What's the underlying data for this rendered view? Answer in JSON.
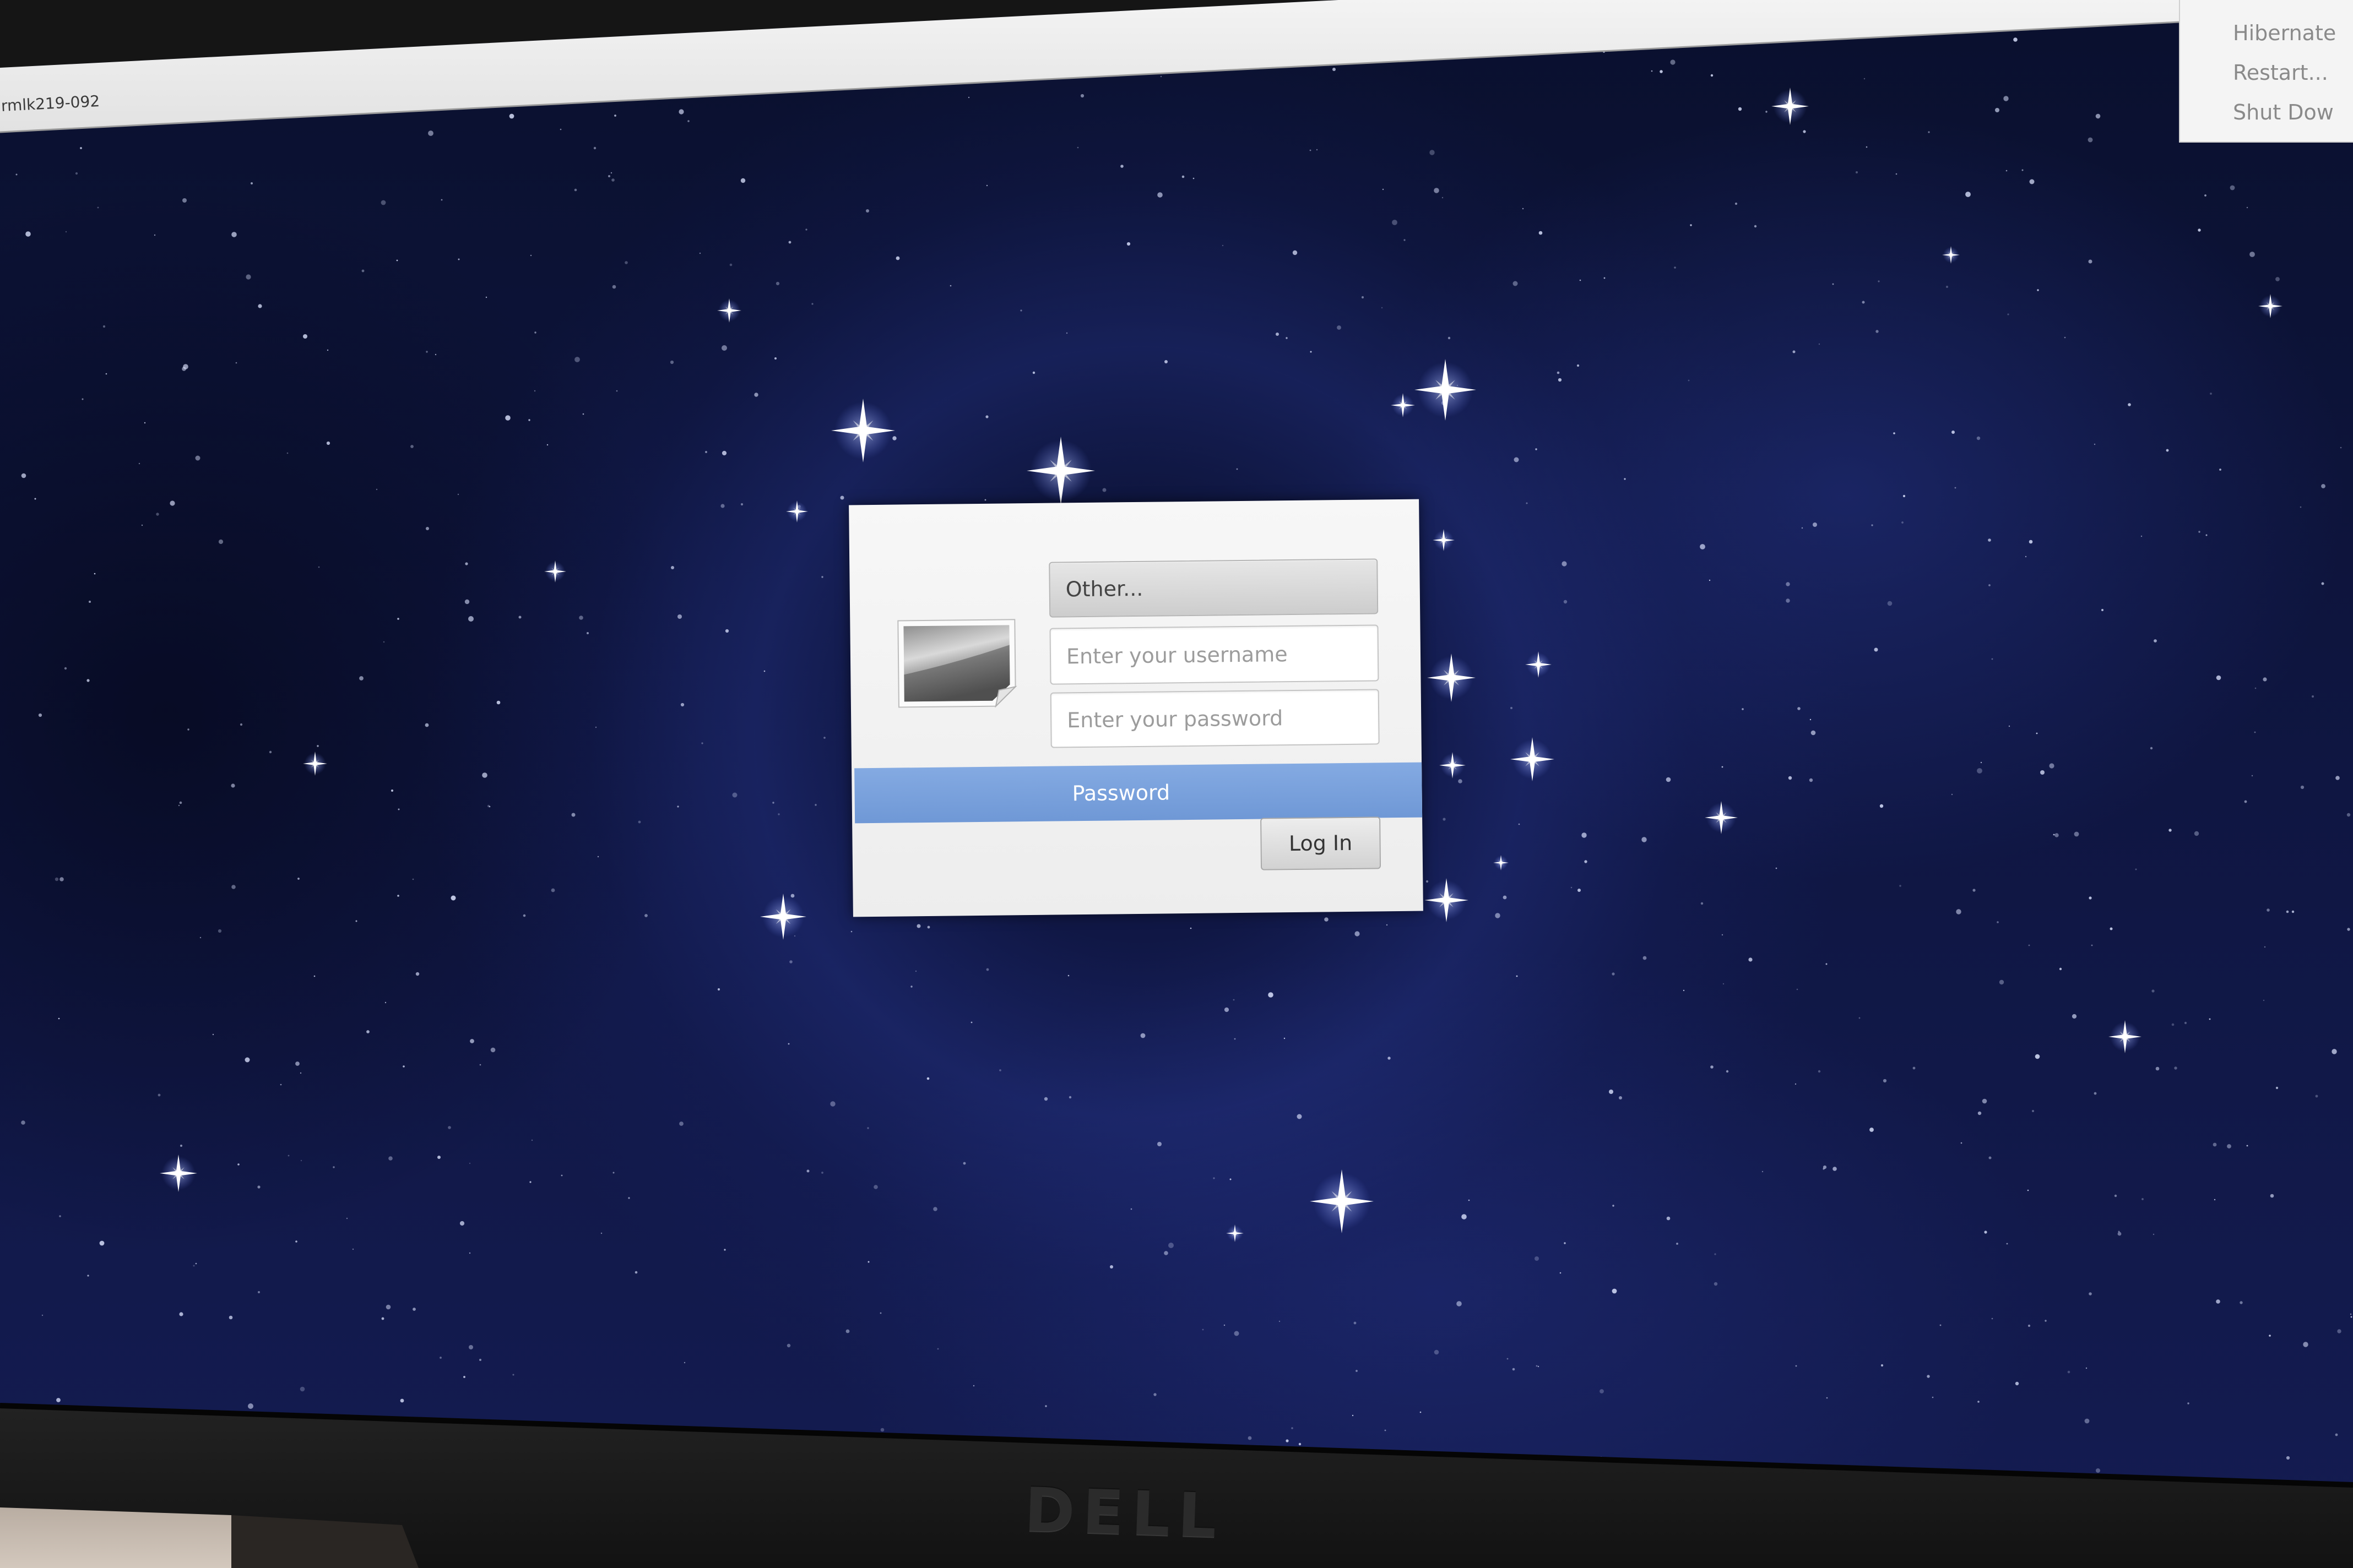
{
  "top_panel": {
    "hostname": "rmlk219-092"
  },
  "power_menu": {
    "items": [
      {
        "label": "Hibernate"
      },
      {
        "label": "Restart..."
      },
      {
        "label": "Shut Dow"
      }
    ]
  },
  "login": {
    "avatar_icon": "user-picture-icon",
    "user_select": {
      "label": "Other..."
    },
    "username": {
      "placeholder": "Enter your username",
      "value": ""
    },
    "password": {
      "placeholder": "Enter your password",
      "value": ""
    },
    "prompt_bar": {
      "label": "Password"
    },
    "login_button": {
      "label": "Log In"
    }
  },
  "monitor": {
    "brand_logo": "DELL"
  },
  "colors": {
    "background": "#0d1440",
    "accent": "#7aa3dd",
    "dialog": "#f2f2f2",
    "panel": "#ececec"
  }
}
